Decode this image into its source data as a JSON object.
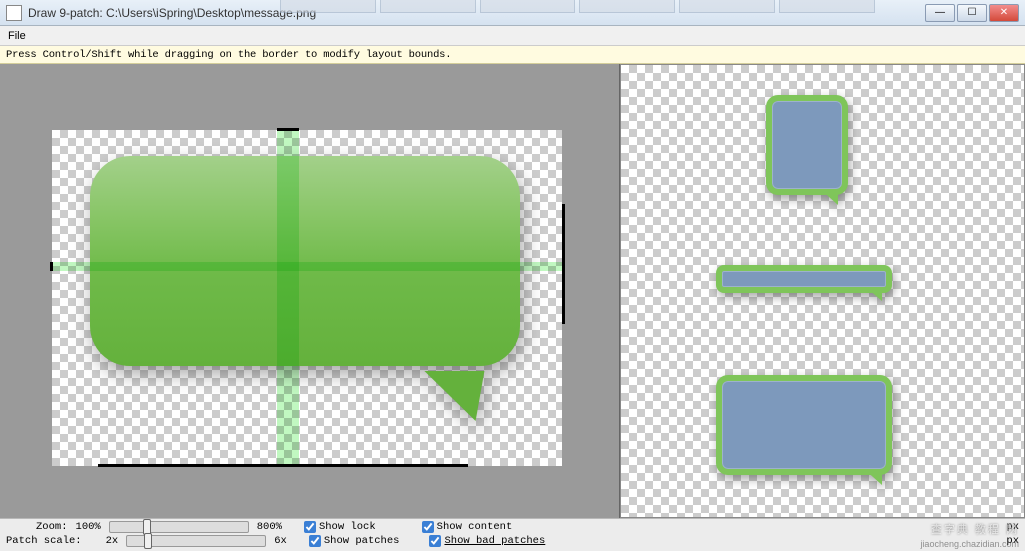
{
  "titlebar": {
    "title": "Draw 9-patch: C:\\Users\\iSpring\\Desktop\\message.png"
  },
  "menu": {
    "file": "File"
  },
  "info": "Press Control/Shift while dragging on the border to modify layout bounds.",
  "bottom": {
    "zoom_label": "Zoom:",
    "zoom_min": "100%",
    "zoom_max": "800%",
    "patch_label": "Patch scale:",
    "patch_min": "2x",
    "patch_max": "6x",
    "show_lock": "Show lock",
    "show_patches": "Show patches",
    "show_content": "Show content",
    "show_bad_patches": "Show bad patches"
  },
  "sliders": {
    "zoom_percent": 24,
    "patch_percent": 12
  },
  "checkboxes": {
    "show_lock": true,
    "show_patches": true,
    "show_content": true,
    "show_bad_patches": true
  },
  "dims": {
    "px_label": "px"
  },
  "watermark": "查字典 教程 网",
  "subwatermark": "jiaocheng.chazidian.com"
}
